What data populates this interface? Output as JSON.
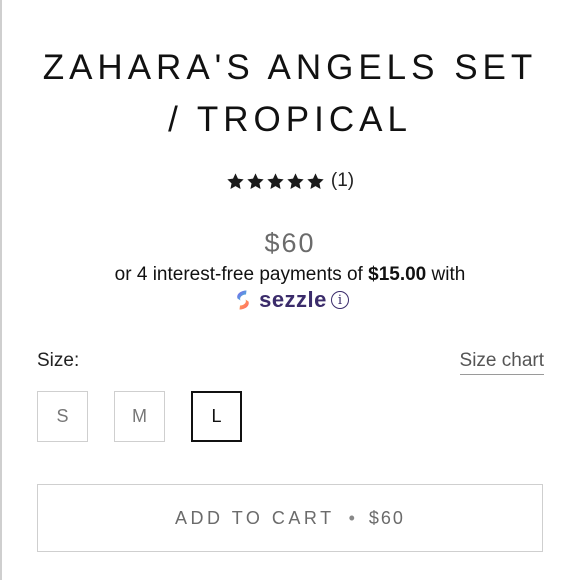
{
  "product": {
    "title_line1": "ZAHARA'S ANGELS SET",
    "title_line2": "/ TROPICAL",
    "rating": 5,
    "review_count": "(1)",
    "price": "$60"
  },
  "sezzle": {
    "text_prefix": "or 4 interest-free payments of ",
    "amount": "$15.00",
    "text_suffix": " with",
    "brand": "sezzle",
    "info_symbol": "i",
    "brand_color": "#3b2c6b"
  },
  "size": {
    "label": "Size:",
    "chart_link": "Size chart",
    "options": [
      "S",
      "M",
      "L"
    ],
    "selected": "L"
  },
  "cart": {
    "button_label": "ADD TO CART",
    "separator": "•",
    "price": "$60"
  },
  "icons": {
    "star": "star-icon",
    "sezzle_logo": "sezzle-logo-icon",
    "info": "info-icon"
  }
}
